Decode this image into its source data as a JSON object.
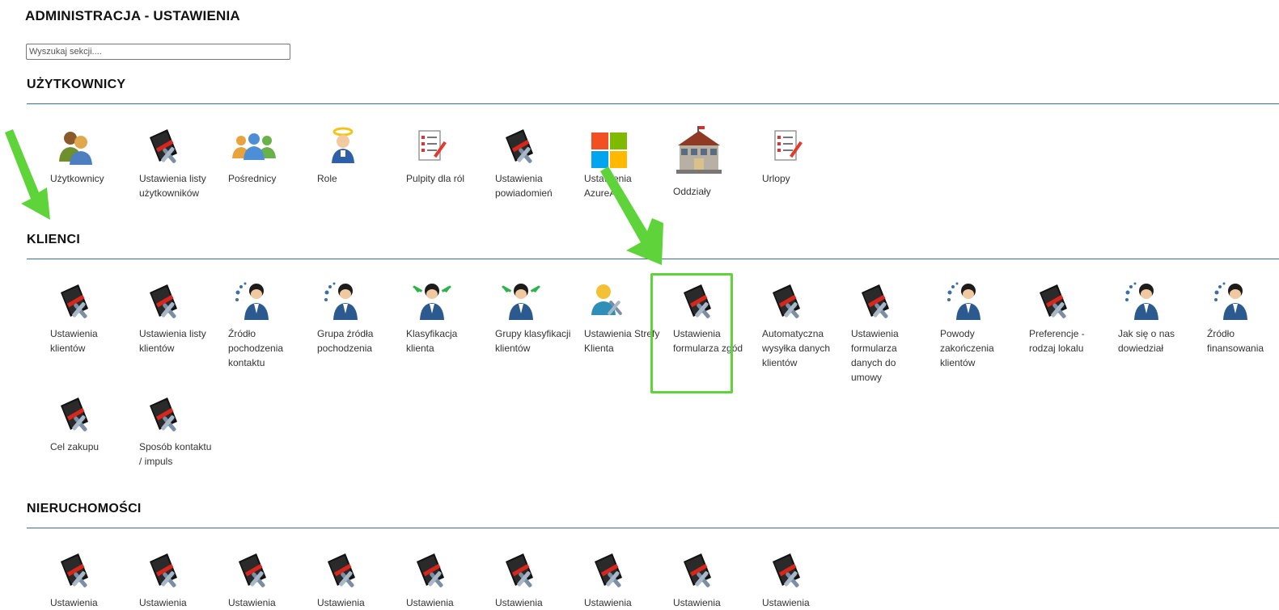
{
  "page": {
    "title": "ADMINISTRACJA - USTAWIENIA"
  },
  "search": {
    "placeholder": "Wyszukaj sekcji...."
  },
  "colors": {
    "rule": "#3a6e9e",
    "highlight": "#5ed43a",
    "arrow": "#5ed43a"
  },
  "sections": [
    {
      "title": "UŻYTKOWNICY",
      "tiles": [
        {
          "label": "Użytkownicy",
          "icon": "users-icon"
        },
        {
          "label": "Ustawienia listy użytkowników",
          "icon": "settings-tools-icon"
        },
        {
          "label": "Pośrednicy",
          "icon": "group-icon"
        },
        {
          "label": "Role",
          "icon": "angel-user-icon"
        },
        {
          "label": "Pulpity dla ról",
          "icon": "checklist-icon"
        },
        {
          "label": "Ustawienia powiadomień",
          "icon": "settings-tools-icon"
        },
        {
          "label": "Ustawienia AzureAD",
          "icon": "windows-logo-icon"
        },
        {
          "label": "Oddziały",
          "icon": "building-icon"
        },
        {
          "label": "Urlopy",
          "icon": "checklist-icon"
        }
      ]
    },
    {
      "title": "KLIENCI",
      "tiles": [
        {
          "label": "Ustawienia klientów",
          "icon": "settings-tools-icon"
        },
        {
          "label": "Ustawienia listy klientów",
          "icon": "settings-tools-icon"
        },
        {
          "label": "Źródło pochodzenia kontaktu",
          "icon": "client-source-icon"
        },
        {
          "label": "Grupa źródła pochodzenia",
          "icon": "client-source-icon"
        },
        {
          "label": "Klasyfikacja klienta",
          "icon": "client-classify-icon"
        },
        {
          "label": "Grupy klasyfikacji klientów",
          "icon": "client-classify-icon"
        },
        {
          "label": "Ustawienia Strefy Klienta",
          "icon": "user-tools-icon"
        },
        {
          "label": "Ustawienia formularza zgód",
          "icon": "settings-tools-icon"
        },
        {
          "label": "Automatyczna wysyłka danych klientów",
          "icon": "settings-tools-icon"
        },
        {
          "label": "Ustawienia formularza danych do umowy",
          "icon": "settings-tools-icon"
        },
        {
          "label": "Powody zakończenia klientów",
          "icon": "client-source-icon"
        },
        {
          "label": "Preferencje - rodzaj lokalu",
          "icon": "settings-tools-icon"
        },
        {
          "label": "Jak się o nas dowiedział",
          "icon": "client-source-icon"
        },
        {
          "label": "Źródło finansowania",
          "icon": "client-source-icon"
        },
        {
          "label": "Cel zakupu",
          "icon": "settings-tools-icon"
        },
        {
          "label": "Sposób kontaktu / impuls",
          "icon": "settings-tools-icon"
        }
      ]
    },
    {
      "title": "NIERUCHOMOŚCI",
      "tiles": [
        {
          "label": "Ustawienia",
          "icon": "settings-tools-icon"
        },
        {
          "label": "Ustawienia",
          "icon": "settings-tools-icon"
        },
        {
          "label": "Ustawienia",
          "icon": "settings-tools-icon"
        },
        {
          "label": "Ustawienia",
          "icon": "settings-tools-icon"
        },
        {
          "label": "Ustawienia",
          "icon": "settings-tools-icon"
        },
        {
          "label": "Ustawienia",
          "icon": "settings-tools-icon"
        },
        {
          "label": "Ustawienia",
          "icon": "settings-tools-icon"
        },
        {
          "label": "Ustawienia",
          "icon": "settings-tools-icon"
        },
        {
          "label": "Ustawienia",
          "icon": "settings-tools-icon"
        }
      ]
    }
  ]
}
